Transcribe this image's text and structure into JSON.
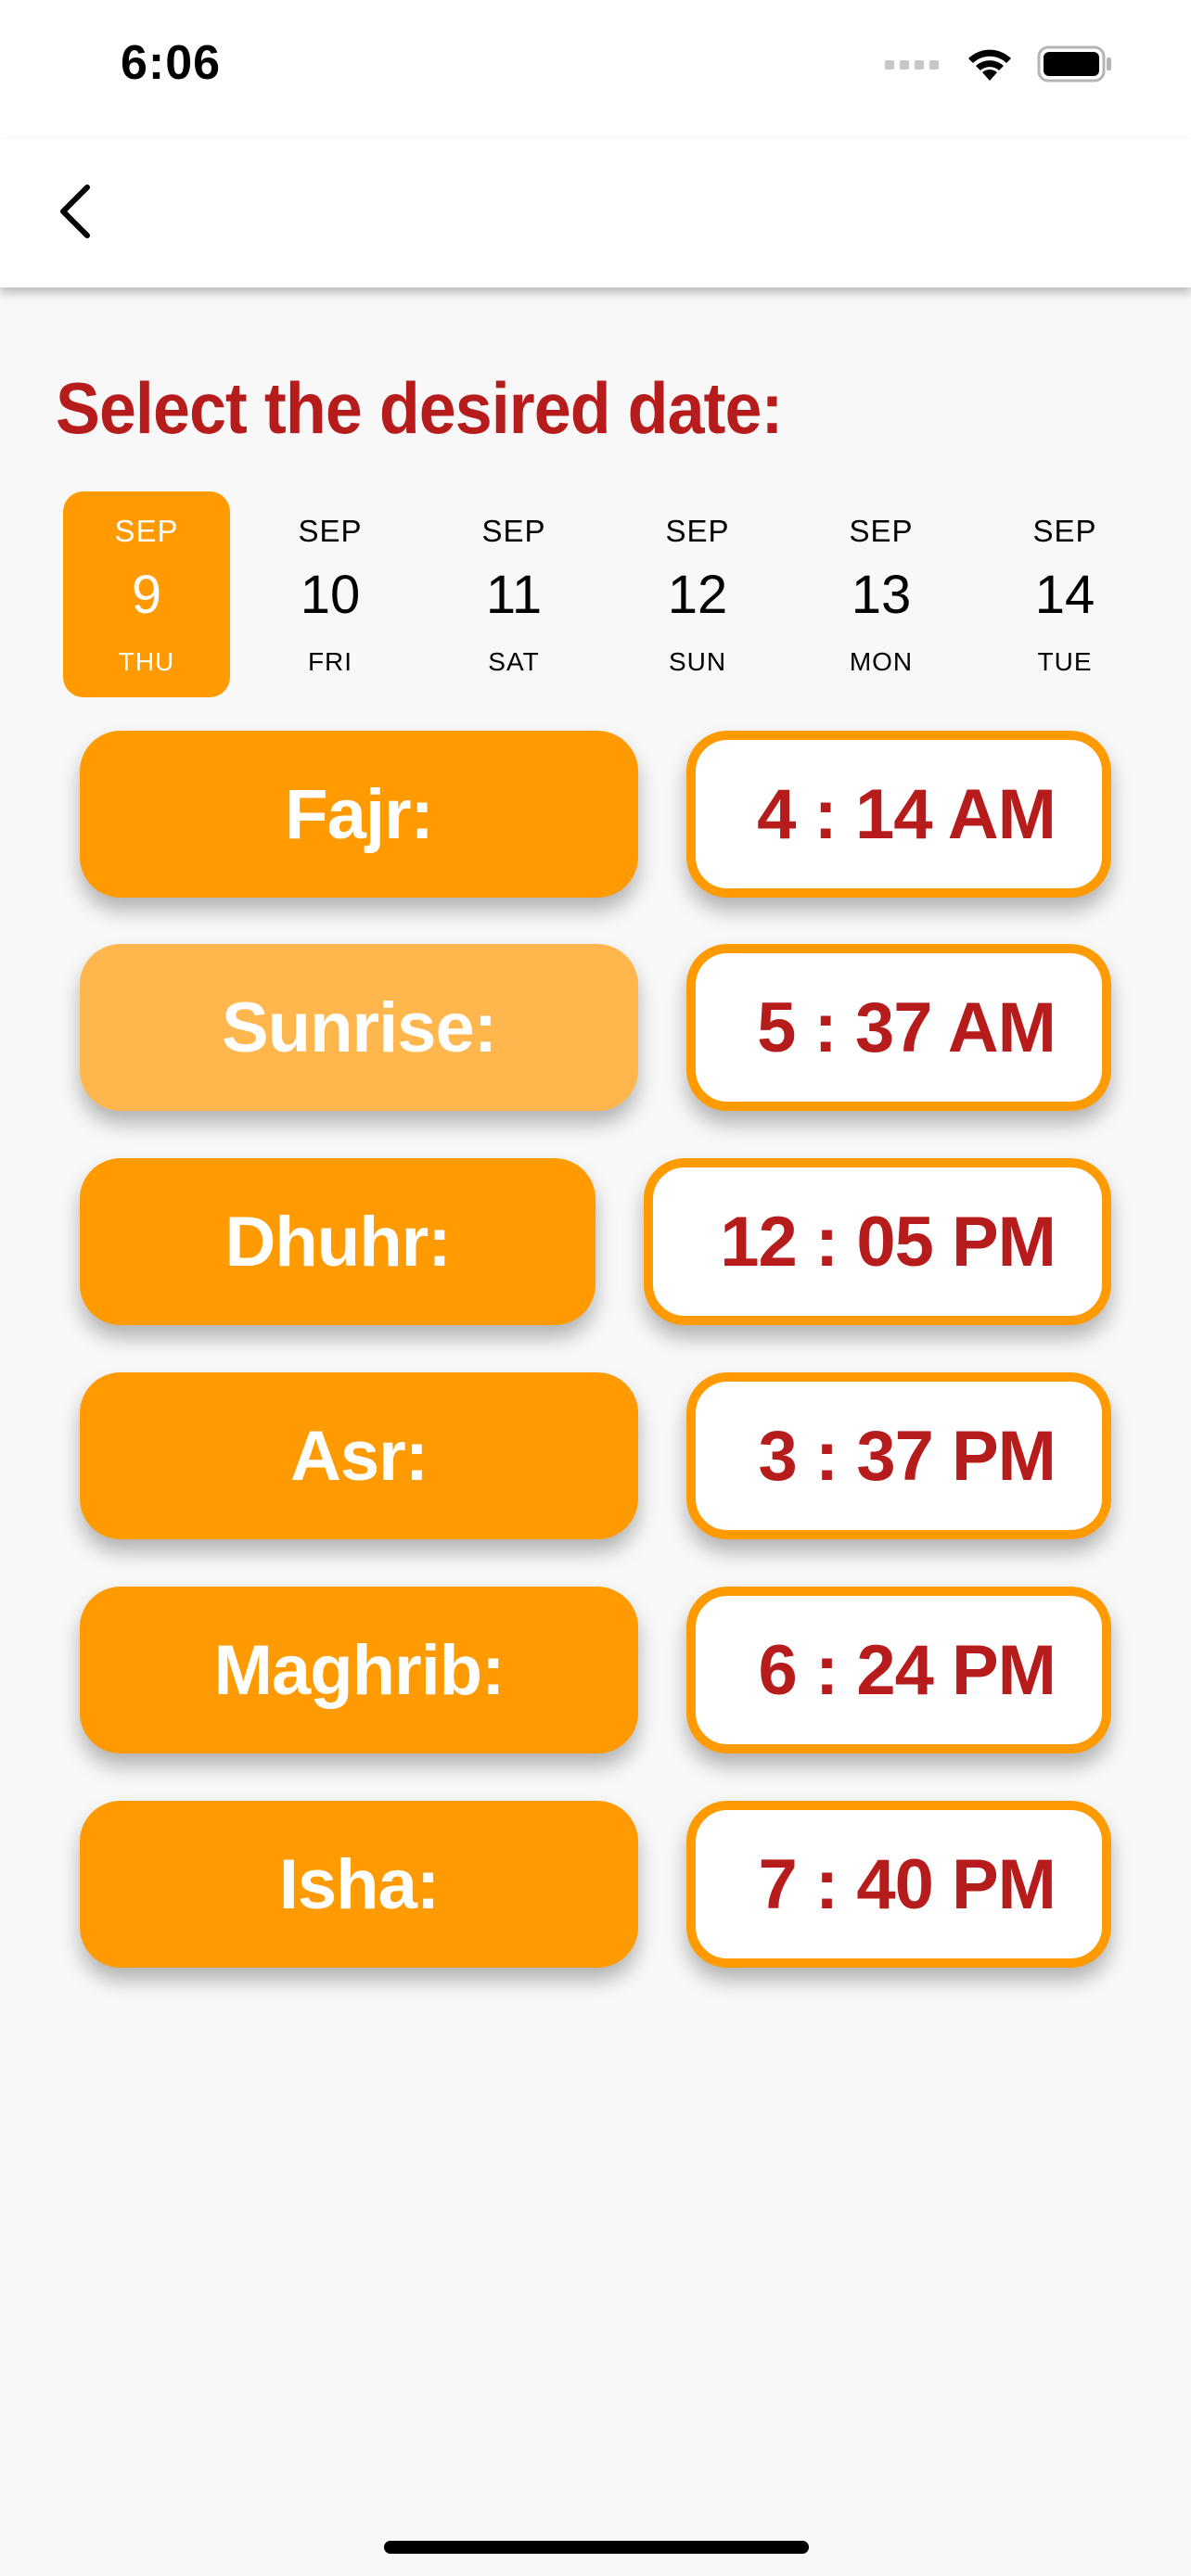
{
  "status_bar": {
    "time": "6:06"
  },
  "page": {
    "title": "Select the desired date:"
  },
  "dates": [
    {
      "month": "SEP",
      "day": "9",
      "weekday": "THU",
      "selected": true
    },
    {
      "month": "SEP",
      "day": "10",
      "weekday": "FRI",
      "selected": false
    },
    {
      "month": "SEP",
      "day": "11",
      "weekday": "SAT",
      "selected": false
    },
    {
      "month": "SEP",
      "day": "12",
      "weekday": "SUN",
      "selected": false
    },
    {
      "month": "SEP",
      "day": "13",
      "weekday": "MON",
      "selected": false
    },
    {
      "month": "SEP",
      "day": "14",
      "weekday": "TUE",
      "selected": false
    }
  ],
  "prayers": [
    {
      "name": "Fajr:",
      "time": "4 : 14 AM"
    },
    {
      "name": "Sunrise:",
      "time": "5 : 37 AM"
    },
    {
      "name": "Dhuhr:",
      "time": "12 : 05 PM"
    },
    {
      "name": "Asr:",
      "time": "3 : 37 PM"
    },
    {
      "name": "Maghrib:",
      "time": "6 : 24 PM"
    },
    {
      "name": "Isha:",
      "time": "7 : 40 PM"
    }
  ],
  "colors": {
    "accent": "#ff9a00",
    "accent_light": "#ffb74d",
    "title_red": "#b71c1c",
    "background": "#f8f8f8"
  },
  "icons": {
    "back": "chevron-left-icon",
    "signal": "cellular-signal-icon",
    "wifi": "wifi-icon",
    "battery": "battery-icon"
  }
}
